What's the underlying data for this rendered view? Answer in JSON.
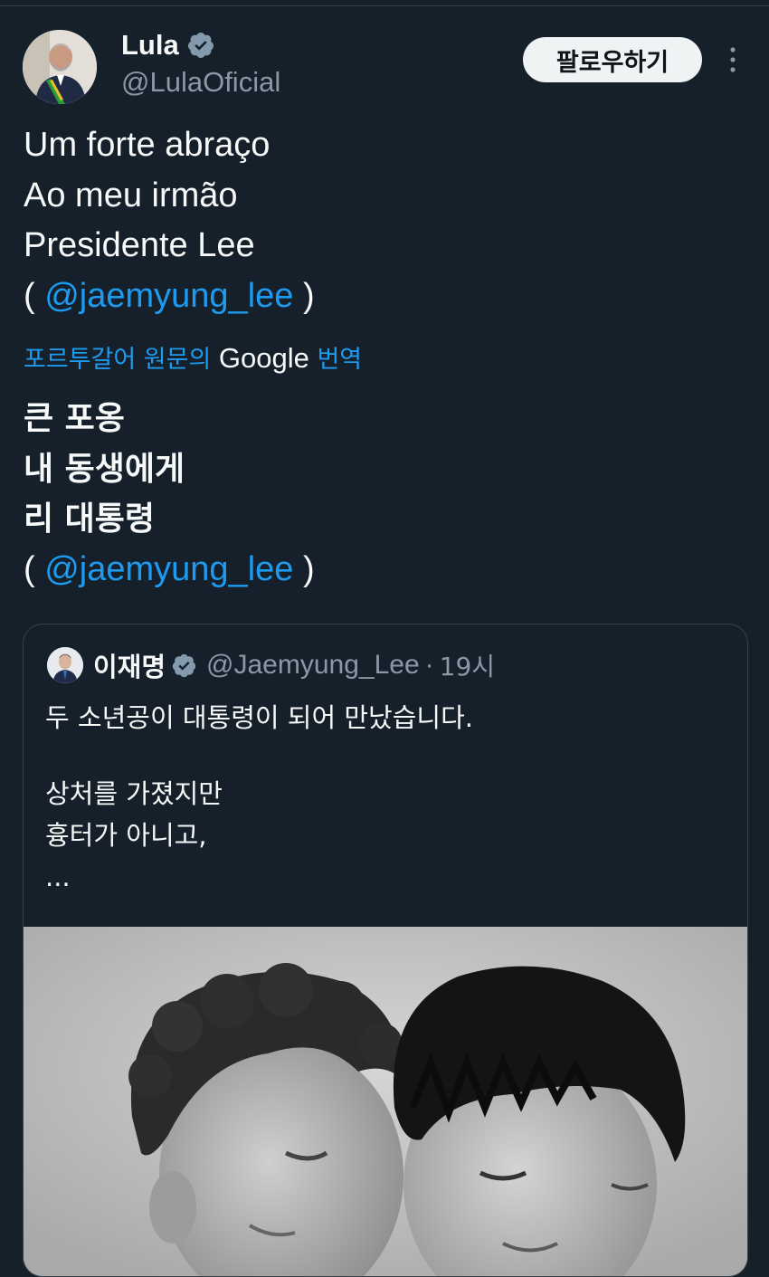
{
  "tweet": {
    "author": {
      "display_name": "Lula",
      "handle": "@LulaOficial",
      "verified": true,
      "avatar_icon": "avatar-photo"
    },
    "follow_label": "팔로우하기",
    "more_icon": "more-vertical-icon",
    "original_text": {
      "line1": "Um forte abraço",
      "line2": "Ao meu irmão",
      "line3": "Presidente Lee",
      "mention_open": "( ",
      "mention": "@jaemyung_lee",
      "mention_close": " )"
    },
    "translation_note": {
      "prefix": "포르투갈어 원문의 ",
      "google": "Google",
      "suffix": " 번역"
    },
    "translated_text": {
      "line1": "큰 포옹",
      "line2": "내 동생에게",
      "line3": "리 대통령",
      "mention_open": "( ",
      "mention": "@jaemyung_lee",
      "mention_close": " )"
    }
  },
  "quote": {
    "author": {
      "display_name": "이재명",
      "handle": "@Jaemyung_Lee",
      "separator": "·",
      "time": "19시",
      "verified": true
    },
    "body": {
      "line1": "두 소년공이 대통령이 되어 만났습니다.",
      "line2": "상처를 가졌지만",
      "line3": "흉터가 아니고,",
      "line4": "..."
    },
    "media": {
      "type": "black-and-white photo",
      "icon": "photo"
    }
  },
  "colors": {
    "background": "#15202b",
    "text": "#f7f9f9",
    "secondary": "#8b98a5",
    "link": "#1d9bf0",
    "verified_badge": "#829aab",
    "border": "#38444d"
  }
}
